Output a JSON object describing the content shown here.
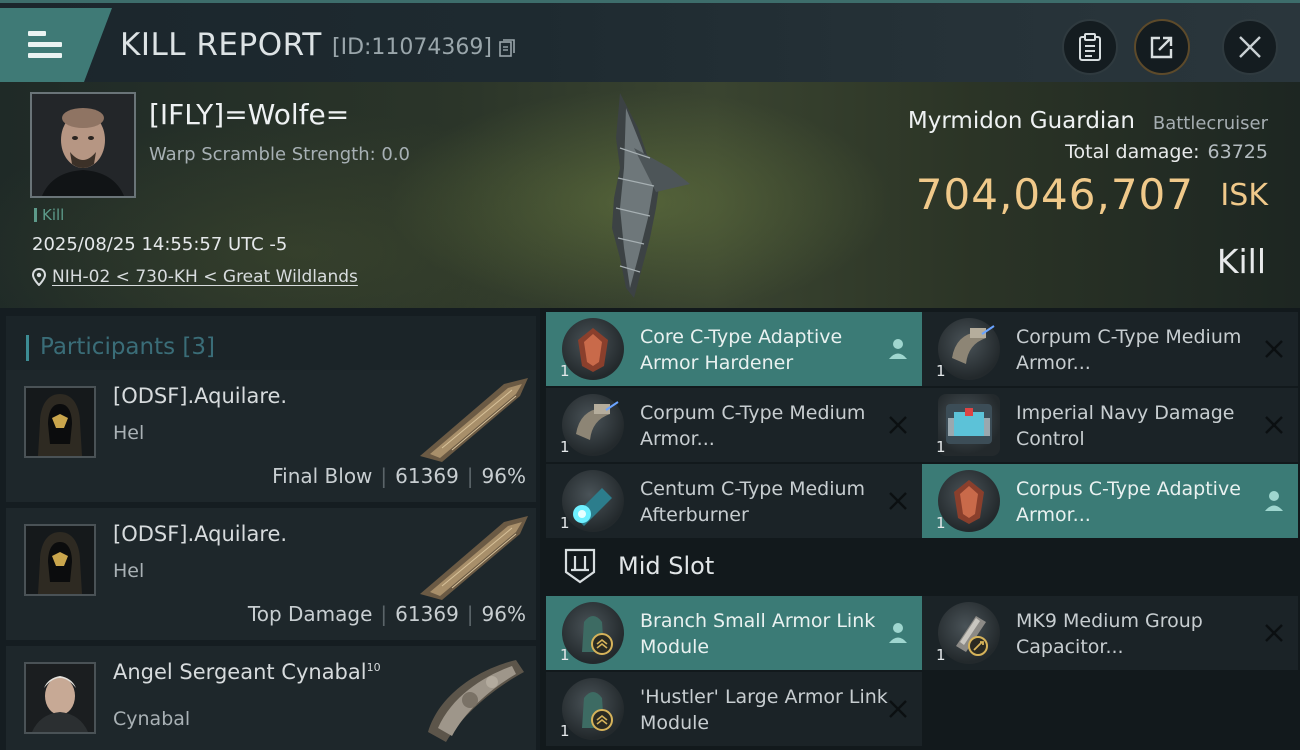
{
  "header": {
    "title": "KILL REPORT",
    "report_id": "[ID:11074369]"
  },
  "victim": {
    "name": "[IFLY]=Wolfe=",
    "warp_scramble": "Warp Scramble Strength: 0.0",
    "tag": "Kill",
    "datetime": "2025/08/25 14:55:57 UTC -5",
    "location": "NIH-02 < 730-KH < Great Wildlands",
    "ship_name": "Myrmidon Guardian",
    "ship_class": "Battlecruiser",
    "total_damage_label": "Total damage:",
    "total_damage": "63725",
    "isk_value": "704,046,707",
    "isk_unit": "ISK",
    "result": "Kill"
  },
  "participants": {
    "label": "Participants [3]",
    "items": [
      {
        "name": "[ODSF].Aquilare.",
        "ship": "Hel",
        "role": "Final Blow",
        "damage": "61369",
        "percent": "96%"
      },
      {
        "name": "[ODSF].Aquilare.",
        "ship": "Hel",
        "role": "Top Damage",
        "damage": "61369",
        "percent": "96%"
      },
      {
        "name": "Angel Sergeant Cynabal",
        "level": "10",
        "ship": "Cynabal"
      }
    ]
  },
  "modules": {
    "low": [
      {
        "name": "Core C-Type Adaptive Armor Hardener",
        "qty": "1",
        "state": "dropped"
      },
      {
        "name": "Corpum C-Type Medium Armor...",
        "qty": "1",
        "state": "destroyed"
      },
      {
        "name": "Corpum C-Type Medium Armor...",
        "qty": "1",
        "state": "destroyed"
      },
      {
        "name": "Imperial Navy Damage Control",
        "qty": "1",
        "state": "destroyed"
      },
      {
        "name": "Centum C-Type Medium Afterburner",
        "qty": "1",
        "state": "destroyed"
      },
      {
        "name": "Corpus C-Type Adaptive Armor...",
        "qty": "1",
        "state": "dropped"
      }
    ],
    "mid_slot_label": "Mid Slot",
    "mid": [
      {
        "name": "Branch Small Armor Link Module",
        "qty": "1",
        "state": "dropped"
      },
      {
        "name": "MK9 Medium Group Capacitor...",
        "qty": "1",
        "state": "destroyed"
      },
      {
        "name": "'Hustler' Large Armor Link Module",
        "qty": "1",
        "state": "destroyed"
      }
    ]
  },
  "colors": {
    "accent_teal": "#3b7b76",
    "isk_gold": "#f0c98a"
  }
}
